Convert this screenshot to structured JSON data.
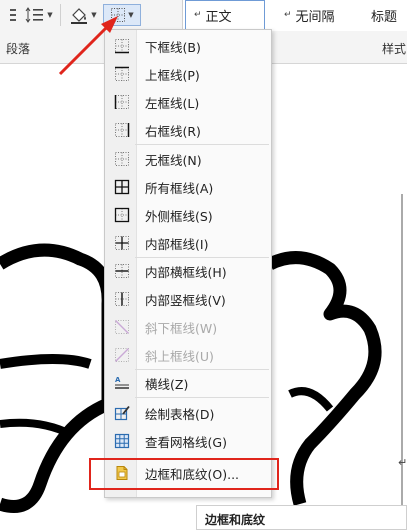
{
  "ribbon": {
    "section_paragraph": "段落",
    "section_styles": "样式",
    "styles": [
      {
        "label": "正文",
        "mark": "↵"
      },
      {
        "label": "无间隔",
        "mark": "↵"
      },
      {
        "label": "标题",
        "mark": ""
      }
    ]
  },
  "menu": {
    "items": [
      {
        "label": "下框线(B)",
        "icon": "border-bottom-icon",
        "enabled": true
      },
      {
        "label": "上框线(P)",
        "icon": "border-top-icon",
        "enabled": true
      },
      {
        "label": "左框线(L)",
        "icon": "border-left-icon",
        "enabled": true
      },
      {
        "label": "右框线(R)",
        "icon": "border-right-icon",
        "enabled": true
      },
      {
        "label": "无框线(N)",
        "icon": "border-none-icon",
        "enabled": true
      },
      {
        "label": "所有框线(A)",
        "icon": "border-all-icon",
        "enabled": true
      },
      {
        "label": "外侧框线(S)",
        "icon": "border-outside-icon",
        "enabled": true
      },
      {
        "label": "内部框线(I)",
        "icon": "border-inside-icon",
        "enabled": true
      },
      {
        "label": "内部横框线(H)",
        "icon": "border-inside-horizontal-icon",
        "enabled": true
      },
      {
        "label": "内部竖框线(V)",
        "icon": "border-inside-vertical-icon",
        "enabled": true
      },
      {
        "label": "斜下框线(W)",
        "icon": "border-diagonal-down-icon",
        "enabled": false
      },
      {
        "label": "斜上框线(U)",
        "icon": "border-diagonal-up-icon",
        "enabled": false
      },
      {
        "label": "横线(Z)",
        "icon": "horizontal-line-icon",
        "enabled": true
      },
      {
        "label": "绘制表格(D)",
        "icon": "draw-table-icon",
        "enabled": true
      },
      {
        "label": "查看网格线(G)",
        "icon": "view-gridlines-icon",
        "enabled": true
      },
      {
        "label": "边框和底纹(O)...",
        "icon": "borders-shading-icon",
        "enabled": true
      }
    ]
  },
  "tooltip": {
    "title": "边框和底纹"
  },
  "colors": {
    "highlight": "#e0251c",
    "icon_blue": "#2b6cb0",
    "disabled": "#a9a9a9"
  }
}
